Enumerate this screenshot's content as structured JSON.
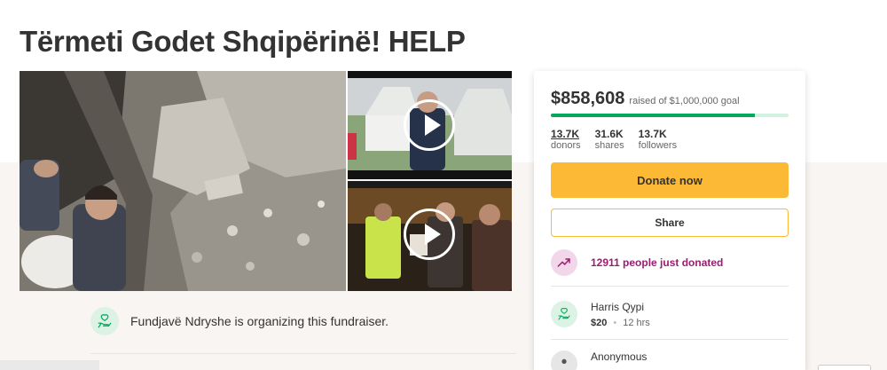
{
  "campaign": {
    "title": "Tërmeti Godet Shqipërinë! HELP",
    "organizer_text": "Fundjavë Ndryshe is organizing this fundraiser."
  },
  "donation_card": {
    "raised": "$858,608",
    "goal_text": "raised of $1,000,000 goal",
    "progress_fraction": 0.8586,
    "stats": {
      "donors_count": "13.7K",
      "donors_label": "donors",
      "shares_count": "31.6K",
      "shares_label": "shares",
      "followers_count": "13.7K",
      "followers_label": "followers"
    },
    "donate_label": "Donate now",
    "share_label": "Share",
    "trend_text": "12911 people just donated",
    "donations": [
      {
        "name": "Harris Qypi",
        "amount": "$20",
        "time": "12 hrs"
      },
      {
        "name": "Anonymous",
        "amount": "",
        "time": ""
      }
    ]
  },
  "icons": {
    "organizer": "heart-hand-icon",
    "trend": "trending-up-icon",
    "donor": "heart-hand-icon",
    "play": "play-icon"
  },
  "colors": {
    "progress": "#02a95c",
    "donate_button": "#fbb936",
    "trend_text": "#9b1c70",
    "icon_green_bg": "#dcf2e5"
  }
}
